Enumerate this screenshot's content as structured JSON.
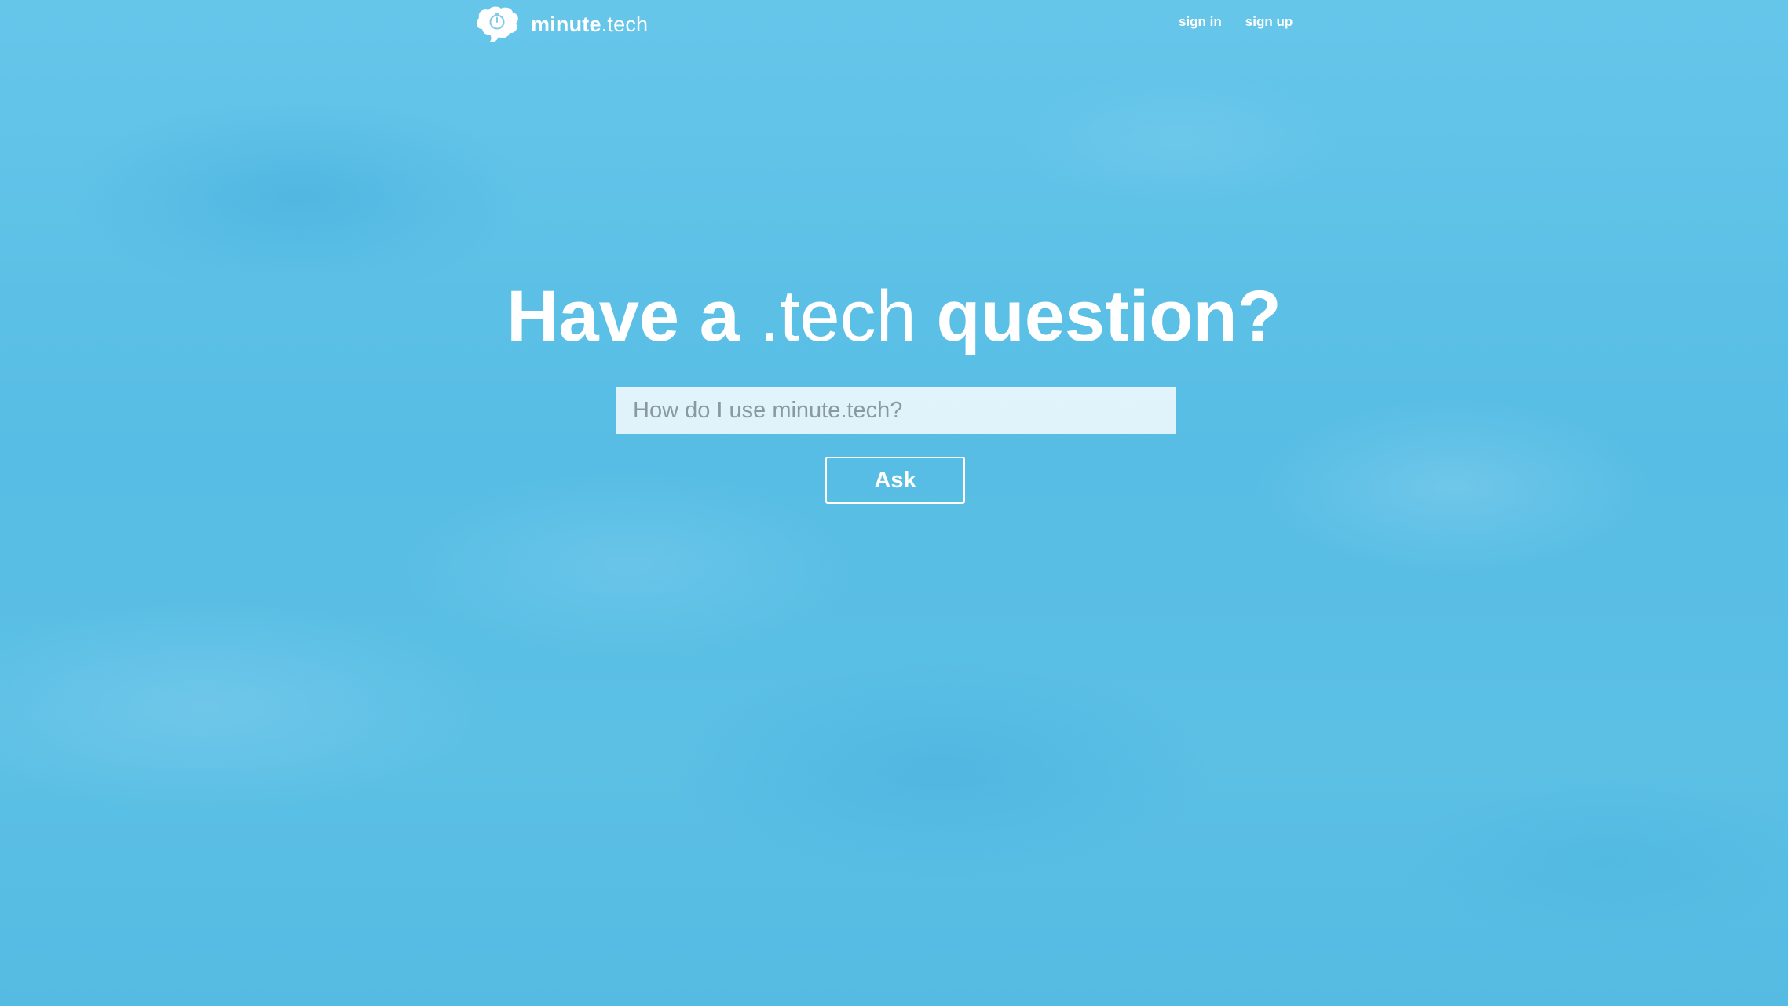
{
  "header": {
    "logo": {
      "icon": "brain-stopwatch-icon",
      "brand_strong": "minute",
      "brand_light": ".tech"
    },
    "nav": {
      "sign_in": "sign in",
      "sign_up": "sign up"
    }
  },
  "hero": {
    "title_part1": "Have a",
    "title_part2": ".tech",
    "title_part3": "question?",
    "search_placeholder": "How do I use minute.tech?",
    "ask_label": "Ask"
  },
  "colors": {
    "background": "#5bbfe4",
    "text": "#ffffff"
  }
}
